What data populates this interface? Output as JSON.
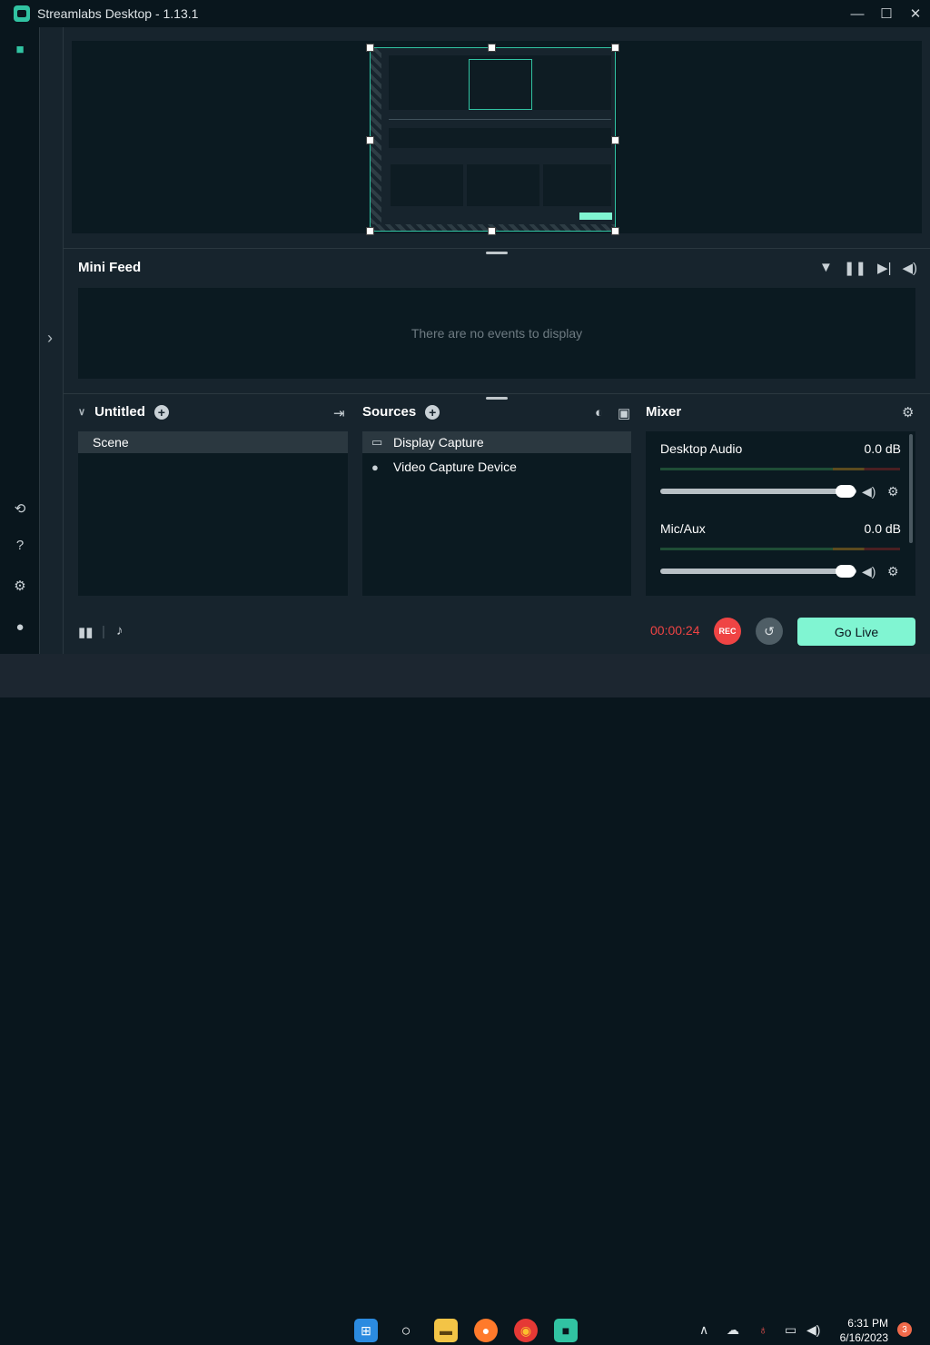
{
  "window": {
    "title": "Streamlabs Desktop - 1.13.1",
    "minimize": "—",
    "maximize": "☐",
    "close": "✕"
  },
  "mini_feed": {
    "title": "Mini Feed",
    "empty_text": "There are no events to display"
  },
  "scenes": {
    "collection_name": "Untitled",
    "items": [
      "Scene"
    ]
  },
  "sources": {
    "title": "Sources",
    "items": [
      {
        "label": "Display Capture",
        "icon": "monitor-icon"
      },
      {
        "label": "Video Capture Device",
        "icon": "webcam-icon"
      }
    ]
  },
  "mixer": {
    "title": "Mixer",
    "channels": [
      {
        "name": "Desktop Audio",
        "level": "0.0 dB",
        "volume_fraction": 1.0
      },
      {
        "name": "Mic/Aux",
        "level": "0.0 dB",
        "volume_fraction": 1.0
      }
    ]
  },
  "footer": {
    "timer": "00:00:24",
    "rec_label": "REC",
    "go_live_label": "Go Live"
  },
  "taskbar": {
    "time": "6:31 PM",
    "date": "6/16/2023",
    "notification_count": "3"
  },
  "colors": {
    "accent": "#31c3a2",
    "go_live": "#80f5d2",
    "rec": "#ef4444",
    "background": "#17242d"
  }
}
